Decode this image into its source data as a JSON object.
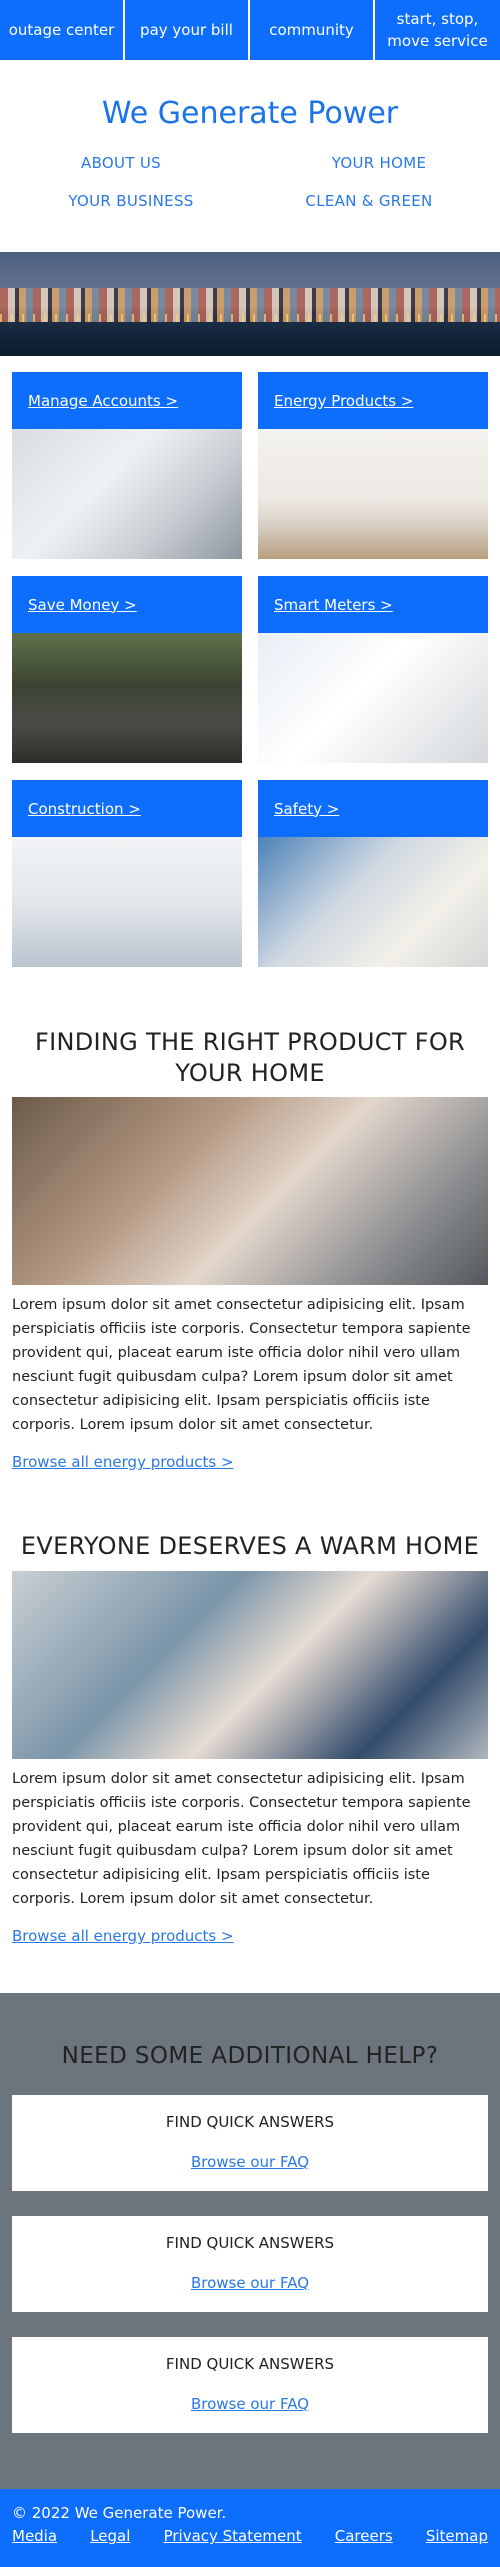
{
  "nav": [
    {
      "label": "outage center"
    },
    {
      "label": "pay your bill"
    },
    {
      "label": "community"
    },
    {
      "label": "start, stop, move service"
    }
  ],
  "brand": {
    "title": "We Generate Power"
  },
  "header_links": [
    {
      "label": "ABOUT US"
    },
    {
      "label": "YOUR HOME"
    },
    {
      "label": "YOUR BUSINESS"
    },
    {
      "label": "CLEAN & GREEN"
    }
  ],
  "cards": [
    {
      "label": "Manage Accounts >"
    },
    {
      "label": "Energy Products >"
    },
    {
      "label": "Save Money >"
    },
    {
      "label": "Smart Meters >"
    },
    {
      "label": "Construction >"
    },
    {
      "label": "Safety >"
    }
  ],
  "section1": {
    "heading": "FINDING THE RIGHT PRODUCT FOR YOUR HOME",
    "body": "Lorem ipsum dolor sit amet consectetur adipisicing elit. Ipsam perspiciatis officiis iste corporis. Consectetur tempora sapiente provident qui, placeat earum iste officia dolor nihil vero ullam nesciunt fugit quibusdam culpa? Lorem ipsum dolor sit amet consectetur adipisicing elit. Ipsam perspiciatis officiis iste corporis. Lorem ipsum dolor sit amet consectetur.",
    "link": "Browse all energy products >"
  },
  "section2": {
    "heading": "EVERYONE DESERVES A WARM HOME",
    "body": "Lorem ipsum dolor sit amet consectetur adipisicing elit. Ipsam perspiciatis officiis iste corporis. Consectetur tempora sapiente provident qui, placeat earum iste officia dolor nihil vero ullam nesciunt fugit quibusdam culpa? Lorem ipsum dolor sit amet consectetur adipisicing elit. Ipsam perspiciatis officiis iste corporis. Lorem ipsum dolor sit amet consectetur.",
    "link": "Browse all energy products >"
  },
  "help": {
    "heading": "NEED SOME ADDITIONAL HELP?",
    "boxes": [
      {
        "title": "FIND QUICK ANSWERS",
        "link": "Browse our FAQ"
      },
      {
        "title": "FIND QUICK ANSWERS",
        "link": "Browse our FAQ"
      },
      {
        "title": "FIND QUICK ANSWERS",
        "link": "Browse our FAQ"
      }
    ]
  },
  "footer": {
    "copyright": "© 2022 We Generate Power.",
    "links": [
      {
        "label": "Media"
      },
      {
        "label": "Legal"
      },
      {
        "label": "Privacy Statement"
      },
      {
        "label": "Careers"
      },
      {
        "label": "Sitemap"
      }
    ]
  },
  "colors": {
    "primary": "#0d6efd",
    "link": "#2a78e4",
    "help_bg": "#6c757d",
    "brand": "#1a73e8"
  }
}
